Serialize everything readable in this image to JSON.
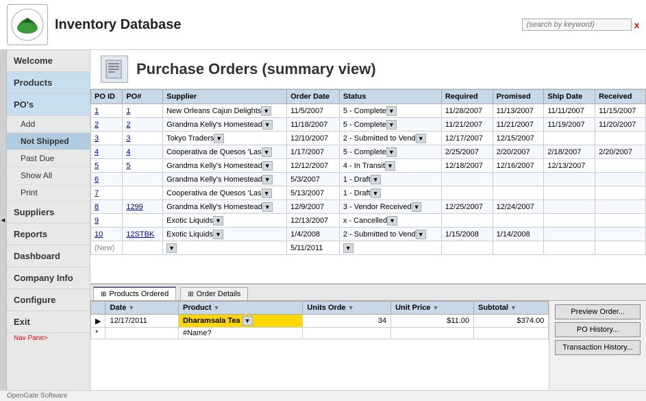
{
  "app": {
    "title": "Inventory Database",
    "logo_text": "OpenGate Software",
    "footer_text": "OpenGate Software"
  },
  "header": {
    "search_placeholder": "(search by keyword)",
    "search_x": "x"
  },
  "sidebar": {
    "items": [
      {
        "id": "welcome",
        "label": "Welcome",
        "active": false,
        "sub": []
      },
      {
        "id": "products",
        "label": "Products",
        "active": false,
        "sub": []
      },
      {
        "id": "pos",
        "label": "PO's",
        "active": true,
        "sub": [
          {
            "id": "add",
            "label": "Add",
            "active": false
          },
          {
            "id": "not-shipped",
            "label": "Not Shipped",
            "active": true
          },
          {
            "id": "past-due",
            "label": "Past Due",
            "active": false
          },
          {
            "id": "show-all",
            "label": "Show All",
            "active": false
          },
          {
            "id": "print",
            "label": "Print",
            "active": false
          }
        ]
      },
      {
        "id": "suppliers",
        "label": "Suppliers",
        "active": false,
        "sub": []
      },
      {
        "id": "reports",
        "label": "Reports",
        "active": false,
        "sub": []
      },
      {
        "id": "dashboard",
        "label": "Dashboard",
        "active": false,
        "sub": []
      },
      {
        "id": "company-info",
        "label": "Company Info",
        "active": false,
        "sub": []
      },
      {
        "id": "configure",
        "label": "Configure",
        "active": false,
        "sub": []
      },
      {
        "id": "exit",
        "label": "Exit",
        "active": false,
        "sub": []
      }
    ],
    "nav_label": "Nav Pane>"
  },
  "page": {
    "title": "Purchase Orders (summary view)"
  },
  "table": {
    "columns": [
      "PO ID",
      "PO#",
      "Supplier",
      "Order Date",
      "Status",
      "Required",
      "Promised",
      "Ship Date",
      "Received"
    ],
    "rows": [
      {
        "po_id": "1",
        "po_num": "1",
        "supplier": "New Orleans Cajun Delights",
        "order_date": "11/5/2007",
        "status": "5 - Complete",
        "required": "11/28/2007",
        "promised": "11/13/2007",
        "ship_date": "11/11/2007",
        "received": "11/15/2007"
      },
      {
        "po_id": "2",
        "po_num": "2",
        "supplier": "Grandma Kelly's Homestead",
        "order_date": "11/18/2007",
        "status": "5 - Complete",
        "required": "11/21/2007",
        "promised": "11/21/2007",
        "ship_date": "11/19/2007",
        "received": "11/20/2007"
      },
      {
        "po_id": "3",
        "po_num": "3",
        "supplier": "Tokyo Traders",
        "order_date": "12/10/2007",
        "status": "2 - Submitted to Vend",
        "required": "12/17/2007",
        "promised": "12/15/2007",
        "ship_date": "",
        "received": ""
      },
      {
        "po_id": "4",
        "po_num": "4",
        "supplier": "Cooperativa de Quesos 'Las",
        "order_date": "1/17/2007",
        "status": "5 - Complete",
        "required": "2/25/2007",
        "promised": "2/20/2007",
        "ship_date": "2/18/2007",
        "received": "2/20/2007"
      },
      {
        "po_id": "5",
        "po_num": "5",
        "supplier": "Grandma Kelly's Homestead",
        "order_date": "12/12/2007",
        "status": "4 - In Transit",
        "required": "12/18/2007",
        "promised": "12/16/2007",
        "ship_date": "12/13/2007",
        "received": ""
      },
      {
        "po_id": "6",
        "po_num": "",
        "supplier": "Grandma Kelly's Homestead",
        "order_date": "5/3/2007",
        "status": "1 - Draft",
        "required": "",
        "promised": "",
        "ship_date": "",
        "received": ""
      },
      {
        "po_id": "7",
        "po_num": "",
        "supplier": "Cooperativa de Quesos 'Las",
        "order_date": "5/13/2007",
        "status": "1 - Draft",
        "required": "",
        "promised": "",
        "ship_date": "",
        "received": ""
      },
      {
        "po_id": "8",
        "po_num": "1299",
        "supplier": "Grandma Kelly's Homestead",
        "order_date": "12/9/2007",
        "status": "3 - Vendor Received",
        "required": "12/25/2007",
        "promised": "12/24/2007",
        "ship_date": "",
        "received": ""
      },
      {
        "po_id": "9",
        "po_num": "",
        "supplier": "Exotic Liquids",
        "order_date": "12/13/2007",
        "status": "x - Cancelled",
        "required": "",
        "promised": "",
        "ship_date": "",
        "received": ""
      },
      {
        "po_id": "10",
        "po_num": "12STBK",
        "supplier": "Exotic Liquids",
        "order_date": "1/4/2008",
        "status": "2 - Submitted to Vend",
        "required": "1/15/2008",
        "promised": "1/14/2008",
        "ship_date": "",
        "received": ""
      },
      {
        "po_id": "(New)",
        "po_num": "",
        "supplier": "",
        "order_date": "5/11/2011",
        "status": "",
        "required": "",
        "promised": "",
        "ship_date": "",
        "received": ""
      }
    ]
  },
  "bottom_panel": {
    "tabs": [
      {
        "id": "products-ordered",
        "label": "Products Ordered",
        "active": true,
        "icon": "table-icon"
      },
      {
        "id": "order-details",
        "label": "Order Details",
        "active": false,
        "icon": "table-icon"
      }
    ],
    "sub_table": {
      "columns": [
        "Date",
        "Product",
        "Units Orde",
        "Unit Price",
        "Subtotal"
      ],
      "rows": [
        {
          "date": "12/17/2011",
          "product": "Dharamsala Tea",
          "units": "34",
          "unit_price": "$11.00",
          "subtotal": "$374.00"
        },
        {
          "date": "",
          "product": "#Name?",
          "units": "",
          "unit_price": "",
          "subtotal": ""
        }
      ]
    },
    "buttons": [
      {
        "id": "preview-order",
        "label": "Preview Order..."
      },
      {
        "id": "po-history",
        "label": "PO History..."
      },
      {
        "id": "transaction-history",
        "label": "Transaction History..."
      }
    ]
  }
}
